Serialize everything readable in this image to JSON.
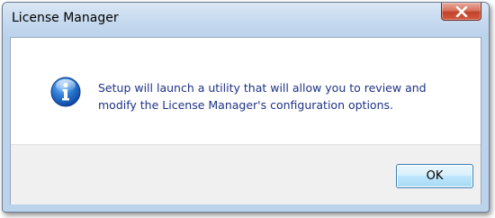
{
  "window": {
    "title": "License Manager"
  },
  "dialog": {
    "icon": "info-icon",
    "message": "Setup will launch a utility that will allow you to review and modify the License Manager's configuration options."
  },
  "buttons": {
    "ok_label": "OK",
    "close_icon": "close-icon"
  },
  "colors": {
    "message_text": "#1e3287",
    "title_bar": "#bcd3ec",
    "close_button": "#c0432b",
    "ok_button_border": "#3c7fb1",
    "footer": "#f0f0f0"
  }
}
